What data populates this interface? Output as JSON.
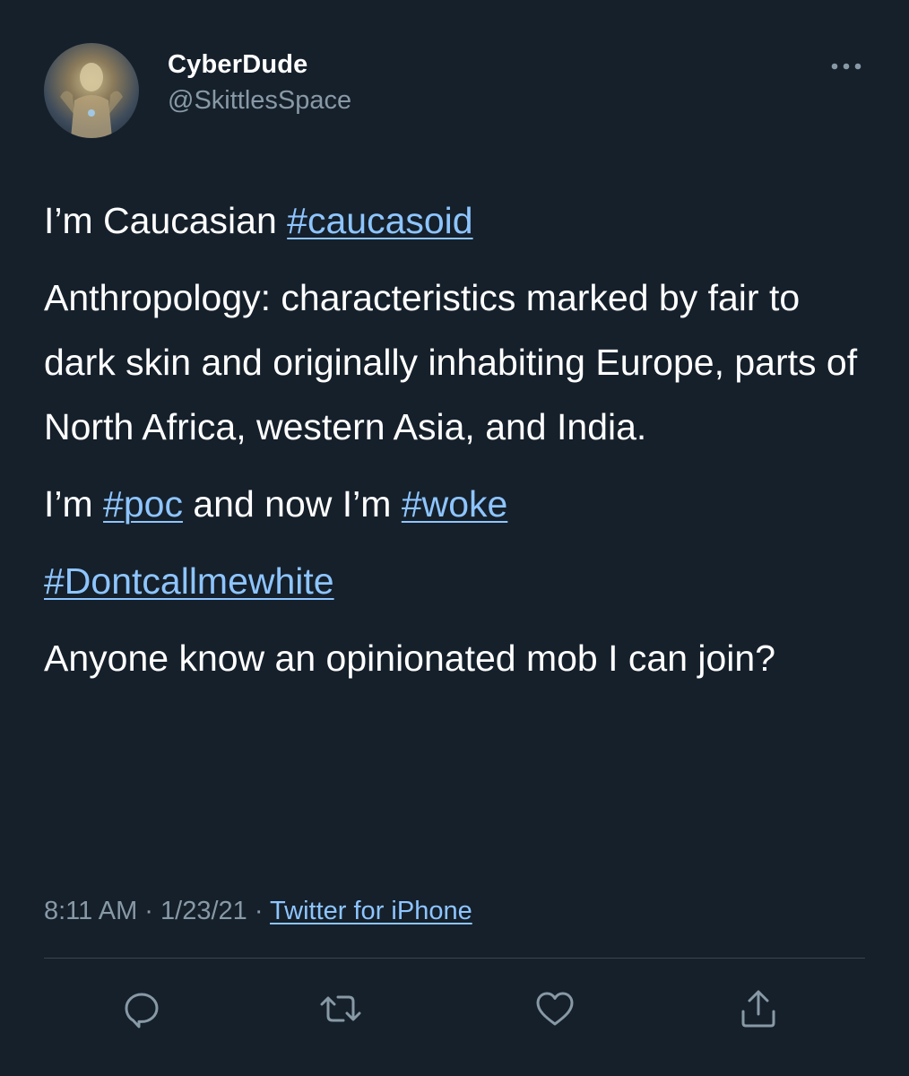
{
  "author": {
    "display_name": "CyberDude",
    "handle": "@SkittlesSpace"
  },
  "tweet": {
    "line1_prefix": "I’m Caucasian ",
    "line1_hashtag": "#caucasoid",
    "paragraph2": "Anthropology: characteristics marked by fair to dark skin and originally inhabiting Europe, parts of North Africa, western Asia, and India.",
    "line3_prefix": "I’m ",
    "line3_hashtag1": "#poc",
    "line3_middle": " and now I’m ",
    "line3_hashtag2": "#woke",
    "line4_hashtag": "#Dontcallmewhite",
    "paragraph5": "Anyone know an opinionated mob I can join?"
  },
  "meta": {
    "time": "8:11 AM",
    "separator1": " · ",
    "date": "1/23/21",
    "separator2": " · ",
    "source": "Twitter for iPhone"
  },
  "colors": {
    "background": "#15202b",
    "text": "#ffffff",
    "secondary": "#8899a6",
    "link": "#8ec5ff"
  },
  "icons": [
    "more-icon",
    "reply-icon",
    "retweet-icon",
    "like-icon",
    "share-icon"
  ]
}
